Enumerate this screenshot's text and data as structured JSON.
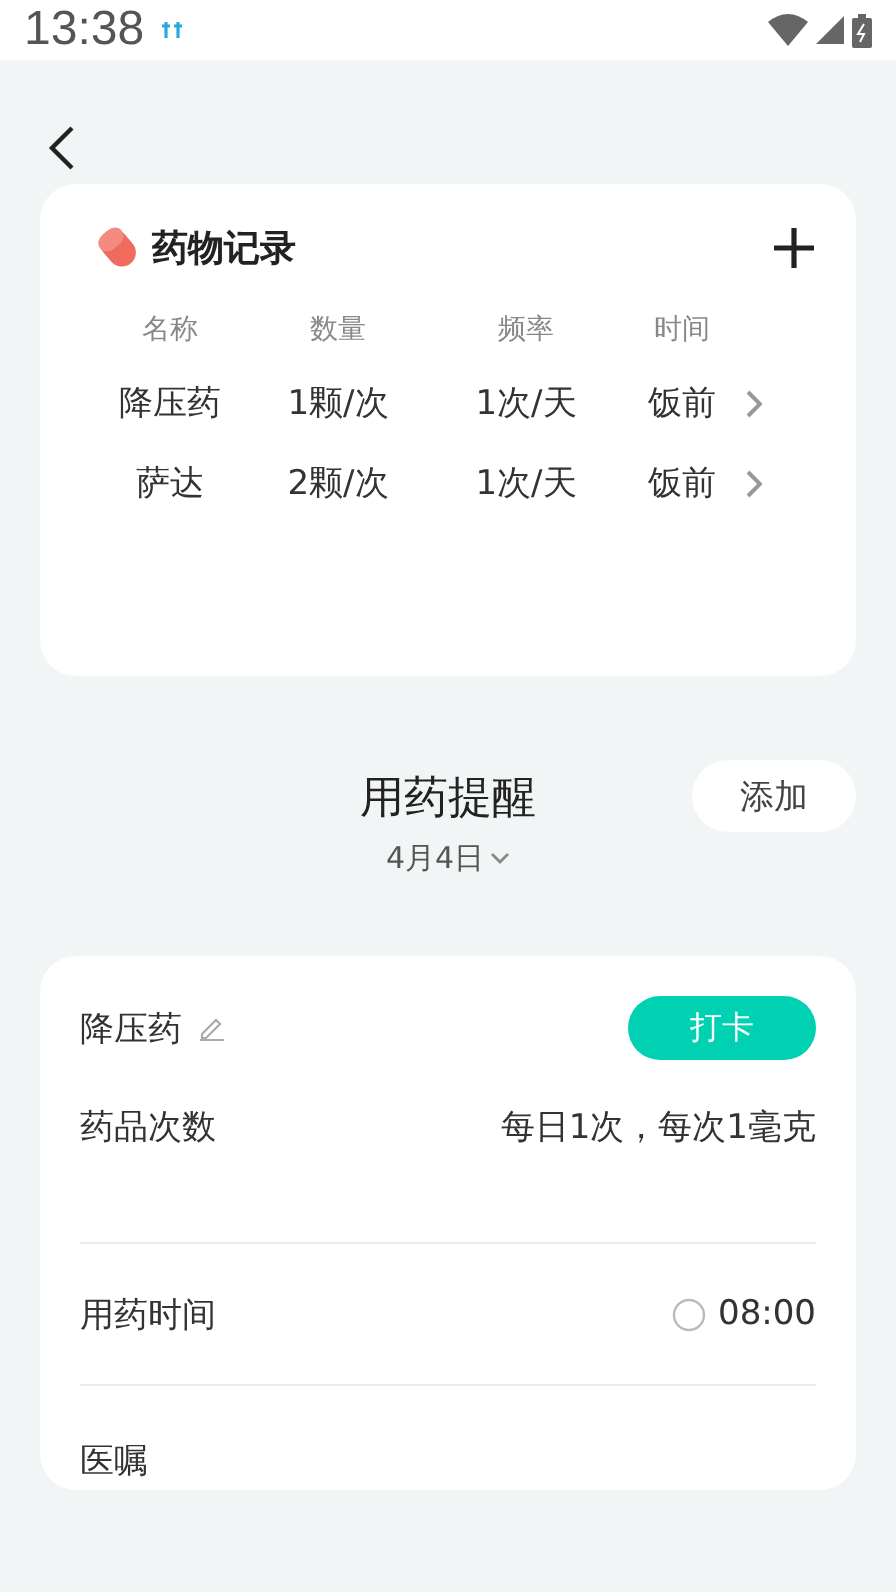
{
  "status_bar": {
    "time": "13:38"
  },
  "records": {
    "title": "药物记录",
    "columns": [
      "名称",
      "数量",
      "频率",
      "时间"
    ],
    "rows": [
      {
        "cells": [
          "降压药",
          "1颗/次",
          "1次/天",
          "饭前"
        ]
      },
      {
        "cells": [
          "萨达",
          "2颗/次",
          "1次/天",
          "饭前"
        ]
      }
    ]
  },
  "reminder": {
    "title": "用药提醒",
    "date": "4月4日",
    "add_button": "添加"
  },
  "reminder_card": {
    "name": "降压药",
    "checkin_button": "打卡",
    "rows": [
      {
        "kind": "text",
        "label": "药品次数",
        "value": "每日1次，每次1毫克"
      },
      {
        "kind": "time",
        "label": "用药时间",
        "value": "08:00"
      },
      {
        "kind": "empty",
        "label": "医嘱"
      }
    ]
  }
}
